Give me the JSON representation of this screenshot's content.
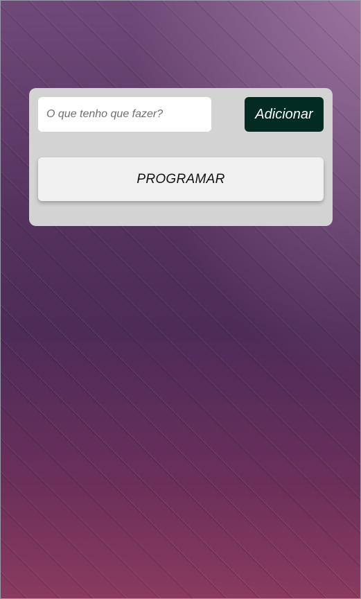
{
  "background": {
    "colors": [
      "#6f4a78",
      "#4d2c58",
      "#8a3a5e"
    ]
  },
  "form": {
    "task_input_placeholder": "O que tenho que fazer?",
    "task_input_value": "",
    "add_label": "Adicionar",
    "add_color": "#022b22",
    "program_label": "PROGRAMAR"
  }
}
